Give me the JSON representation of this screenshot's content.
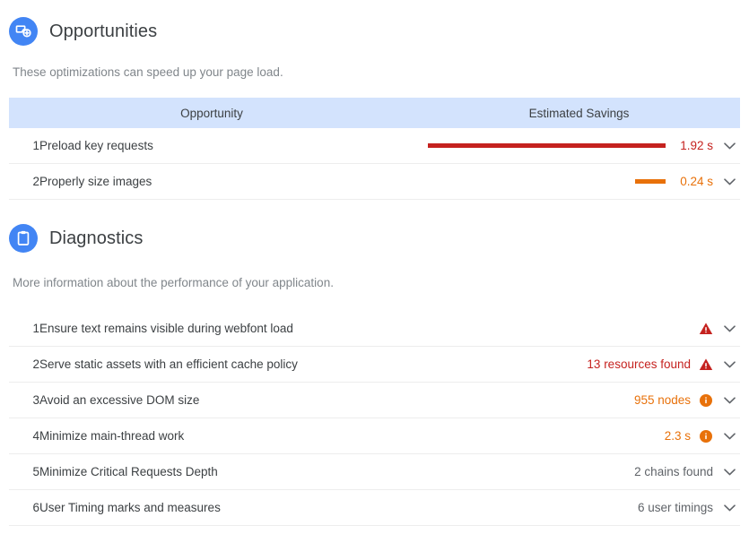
{
  "opportunities": {
    "icon": "opportunities-icon",
    "title": "Opportunities",
    "description": "These optimizations can speed up your page load.",
    "columns": {
      "name": "Opportunity",
      "savings": "Estimated Savings"
    },
    "rows": [
      {
        "index": "1",
        "title": "Preload key requests",
        "value": "1.92 s",
        "bar_pct": 100,
        "bar_color": "#c5221f",
        "severity": "red"
      },
      {
        "index": "2",
        "title": "Properly size images",
        "value": "0.24 s",
        "bar_pct": 13,
        "bar_color": "#e8710a",
        "severity": "orange"
      }
    ]
  },
  "diagnostics": {
    "icon": "diagnostics-icon",
    "title": "Diagnostics",
    "description": "More information about the performance of your application.",
    "rows": [
      {
        "index": "1",
        "title": "Ensure text remains visible during webfont load",
        "value": "",
        "badge": "warning-triangle-icon",
        "severity": "red"
      },
      {
        "index": "2",
        "title": "Serve static assets with an efficient cache policy",
        "value": "13 resources found",
        "badge": "warning-triangle-icon",
        "severity": "red"
      },
      {
        "index": "3",
        "title": "Avoid an excessive DOM size",
        "value": "955 nodes",
        "badge": "info-circle-icon",
        "severity": "orange"
      },
      {
        "index": "4",
        "title": "Minimize main-thread work",
        "value": "2.3 s",
        "badge": "info-circle-icon",
        "severity": "orange"
      },
      {
        "index": "5",
        "title": "Minimize Critical Requests Depth",
        "value": "2 chains found",
        "badge": "",
        "severity": "grey"
      },
      {
        "index": "6",
        "title": "User Timing marks and measures",
        "value": "6 user timings",
        "badge": "",
        "severity": "grey"
      }
    ]
  },
  "colors": {
    "accent_blue": "#4285f4",
    "header_band": "#d3e3fd",
    "severity_red": "#c5221f",
    "severity_orange": "#e8710a",
    "severity_grey": "#5f6368"
  }
}
